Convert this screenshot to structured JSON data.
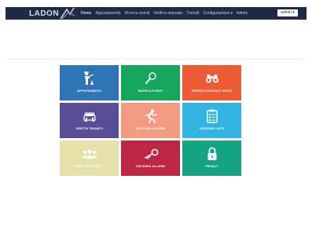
{
  "navbar": {
    "logo_text": "LADON",
    "menu": [
      {
        "label": "Home"
      },
      {
        "label": "Appostamento"
      },
      {
        "label": "Ricerca eventi"
      },
      {
        "label": "Verifica manuale"
      },
      {
        "label": "Transiti"
      },
      {
        "label": "Configurazione ▾"
      },
      {
        "label": "Admin"
      }
    ],
    "user_button": "admin ▾"
  },
  "colors": {
    "navbar": "#1f2a44",
    "tile_appostamento": "#2f75b5",
    "tile_ricerca": "#16a55d",
    "tile_verifica": "#ec5b36",
    "tile_transiti": "#5a4d97",
    "tile_stradale": "#f39b80",
    "tile_liste": "#31b4e2",
    "tile_evento": "#e5e1a8",
    "tile_chiusura": "#be2744",
    "tile_privacy": "#14a383"
  },
  "tiles": [
    {
      "label": "APPOSTAMENTO",
      "icon": "officer-icon"
    },
    {
      "label": "RICERCA EVENTI",
      "icon": "magnifier-icon"
    },
    {
      "label": "VERIFICA MANUALE TARGA",
      "icon": "binoculars-icon"
    },
    {
      "label": "DIRETTA TRANSITI",
      "icon": "car-icon"
    },
    {
      "label": "GESTIONE ALLARMI",
      "icon": "runner-icon"
    },
    {
      "label": "GESTIONE LISTE",
      "icon": "clipboard-icon"
    },
    {
      "label": "GESTIONE EVENTI",
      "icon": "group-icon"
    },
    {
      "label": "CHIUSURA ALLARMI",
      "icon": "key-icon"
    },
    {
      "label": "PRIVACY",
      "icon": "lock-icon"
    }
  ]
}
